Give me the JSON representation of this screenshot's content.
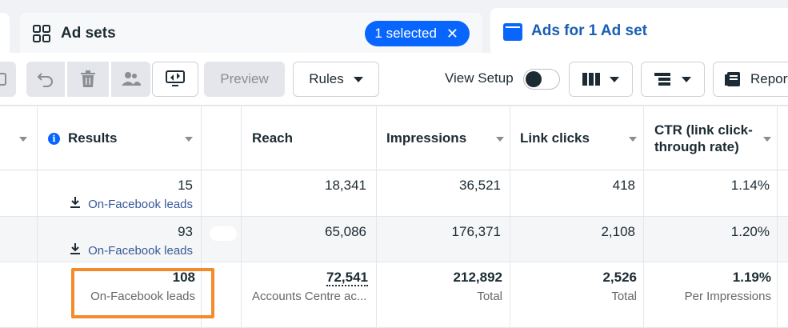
{
  "tabs": {
    "adsets_label": "Ad sets",
    "selected_label": "1 selected",
    "ads_label": "Ads for 1 Ad set"
  },
  "toolbar": {
    "preview_label": "Preview",
    "rules_label": "Rules",
    "view_setup_label": "View Setup",
    "reports_label": "Report"
  },
  "table": {
    "headers": {
      "results": "Results",
      "reach": "Reach",
      "impressions": "Impressions",
      "link_clicks": "Link clicks",
      "ctr_line1": "CTR (link click-",
      "ctr_line2": "through rate)"
    },
    "rows": [
      {
        "results": "15",
        "results_type": "On-Facebook leads",
        "reach": "18,341",
        "impressions": "36,521",
        "link_clicks": "418",
        "ctr": "1.14%"
      },
      {
        "results": "93",
        "results_type": "On-Facebook leads",
        "reach": "65,086",
        "impressions": "176,371",
        "link_clicks": "2,108",
        "ctr": "1.20%"
      }
    ],
    "totals": {
      "results": "108",
      "results_type": "On-Facebook leads",
      "reach": "72,541",
      "reach_note": "Accounts Centre ac...",
      "impressions": "212,892",
      "impressions_note": "Total",
      "link_clicks": "2,526",
      "link_clicks_note": "Total",
      "ctr": "1.19%",
      "ctr_note": "Per Impressions"
    }
  },
  "colors": {
    "accent": "#0866ff",
    "link": "#385898",
    "highlight": "#f28b2b"
  }
}
